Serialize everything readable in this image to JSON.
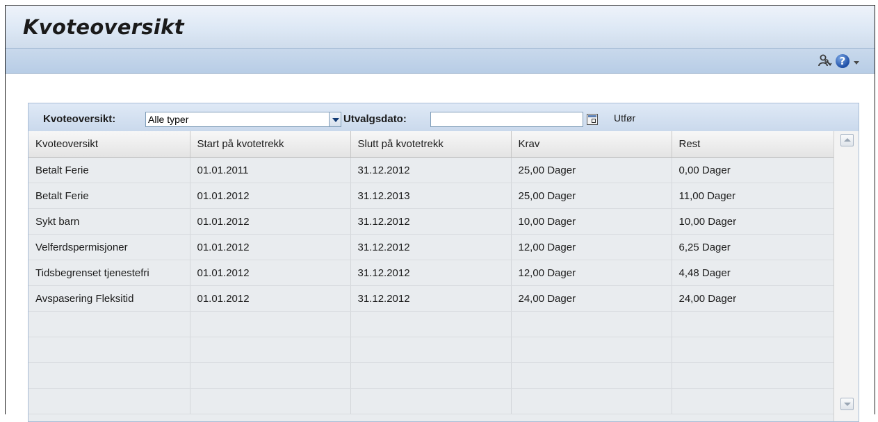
{
  "page": {
    "title": "Kvoteoversikt"
  },
  "filter": {
    "type_label": "Kvoteoversikt:",
    "type_value": "Alle typer",
    "date_label": "Utvalgsdato:",
    "date_value": "",
    "run_label": "Utfør"
  },
  "table": {
    "columns": [
      "Kvoteoversikt",
      "Start på kvotetrekk",
      "Slutt på kvotetrekk",
      "Krav",
      "Rest"
    ],
    "rows": [
      [
        "Betalt Ferie",
        "01.01.2011",
        "31.12.2012",
        "25,00 Dager",
        "0,00 Dager"
      ],
      [
        "Betalt Ferie",
        "01.01.2012",
        "31.12.2013",
        "25,00 Dager",
        "11,00 Dager"
      ],
      [
        "Sykt barn",
        "01.01.2012",
        "31.12.2012",
        "10,00 Dager",
        "10,00 Dager"
      ],
      [
        "Velferdspermisjoner",
        "01.01.2012",
        "31.12.2012",
        "12,00 Dager",
        "6,25 Dager"
      ],
      [
        "Tidsbegrenset tjenestefri",
        "01.01.2012",
        "31.12.2012",
        "12,00 Dager",
        "4,48 Dager"
      ],
      [
        "Avspasering Fleksitid",
        "01.01.2012",
        "31.12.2012",
        "24,00 Dager",
        "24,00 Dager"
      ]
    ]
  },
  "icons": {
    "toolbar": [
      "user-settings-icon",
      "help-icon",
      "dropdown-triangle-icon"
    ],
    "filter": [
      "dropdown-arrow-icon",
      "calendar-icon"
    ]
  },
  "colors": {
    "header_band": "#cfdcec",
    "toolbar_band": "#b8cde6",
    "filter_band": "#cad9ec",
    "row_background": "#e9ecef",
    "help_blue": "#1f4fa6"
  }
}
